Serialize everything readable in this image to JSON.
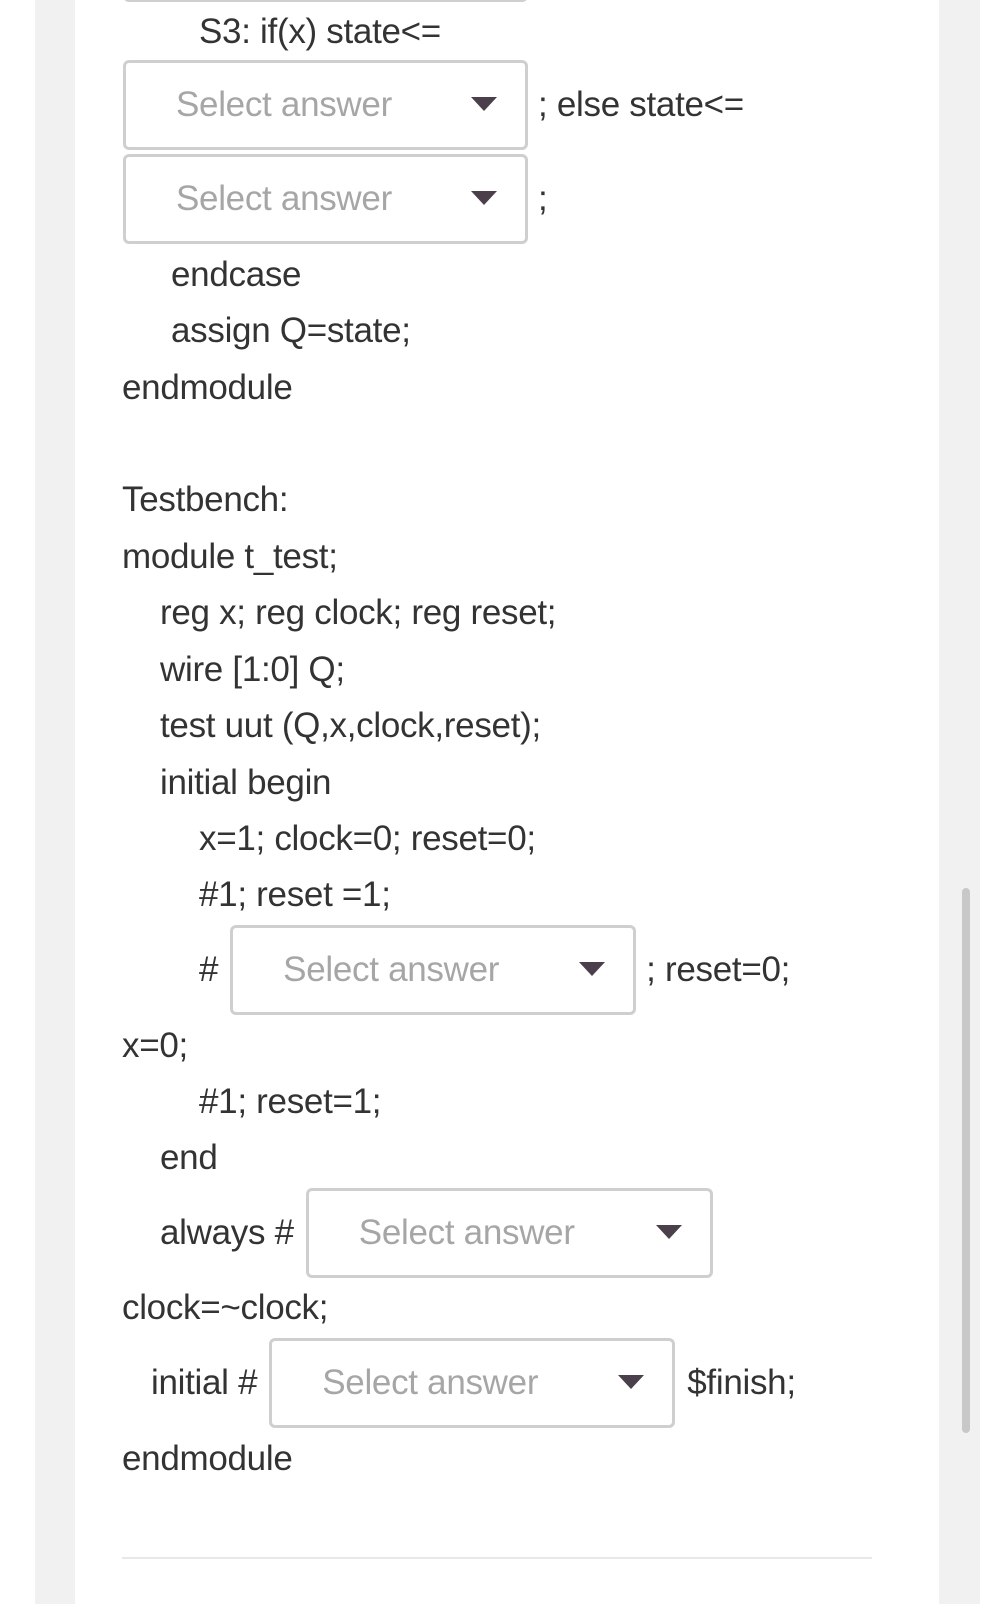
{
  "placeholder": "Select answer",
  "colors": {
    "text": "#333333",
    "placeholder": "#a6a6a6",
    "select_border": "#cfcfcf",
    "arrow": "#4a3f4a",
    "side_band": "#f1f1f1"
  },
  "module_tail": {
    "s3_line": "S3: if(x) state<=",
    "select1_suffix": "; else state<=",
    "select2_suffix": ";",
    "endcase": "endcase",
    "assign": "assign Q=state;",
    "endmodule": "endmodule"
  },
  "testbench": {
    "heading": "Testbench:",
    "module_decl": "module t_test;",
    "regs": "reg x; reg clock; reg reset;",
    "wire": "wire [1:0] Q;",
    "uut": "test uut (Q,x,clock,reset);",
    "initial_begin": "initial begin",
    "init_values": "x=1; clock=0; reset=0;",
    "delay_reset": "#1; reset =1;",
    "select3_prefix": "#",
    "select3_suffix": "; reset=0;",
    "x_zero": "x=0;",
    "delay_reset2": "#1; reset=1;",
    "end": "end",
    "always_prefix": "always #",
    "clock_toggle": "clock=~clock;",
    "initial_prefix": "initial #",
    "initial_suffix": "$finish;",
    "endmodule": "endmodule"
  },
  "selects": [
    {
      "id": "s3-if-state",
      "value": "",
      "placeholder": "Select answer"
    },
    {
      "id": "s3-else-state",
      "value": "",
      "placeholder": "Select answer"
    },
    {
      "id": "reset-delay",
      "value": "",
      "placeholder": "Select answer"
    },
    {
      "id": "clock-period",
      "value": "",
      "placeholder": "Select answer"
    },
    {
      "id": "finish-delay",
      "value": "",
      "placeholder": "Select answer"
    }
  ]
}
